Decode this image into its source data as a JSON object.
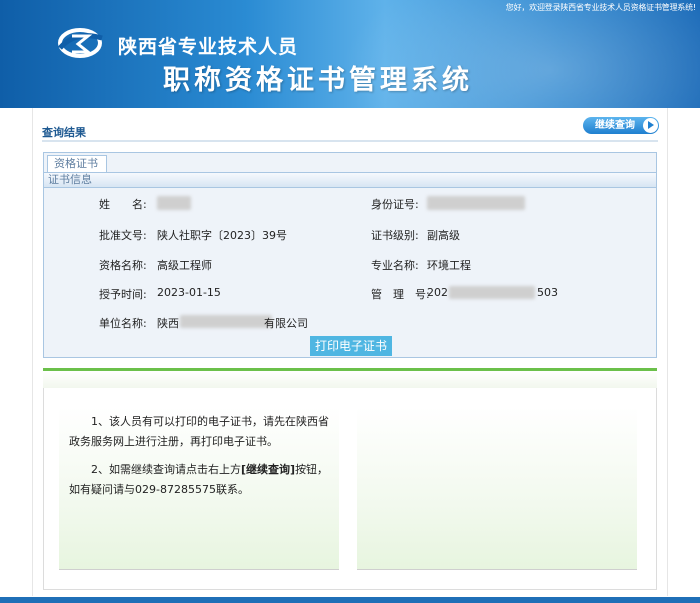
{
  "header": {
    "welcome": "您好，欢迎登录陕西省专业技术人员资格证书管理系统!",
    "title_main": "陕西省专业技术人员",
    "title_sub": "职称资格证书管理系统"
  },
  "result": {
    "title": "查询结果",
    "continue_button": "继续查询"
  },
  "cert": {
    "tab_label": "资格证书",
    "section_label": "证书信息",
    "fields": {
      "name_label": "姓　　名:",
      "id_label": "身份证号:",
      "doc_label": "批准文号:",
      "doc_value": "陕人社职字〔2023〕39号",
      "level_label": "证书级别:",
      "level_value": "副高级",
      "qual_label": "资格名称:",
      "qual_value": "高级工程师",
      "major_label": "专业名称:",
      "major_value": "环境工程",
      "date_label": "授予时间:",
      "date_value": "2023-01-15",
      "mgmt_label": "管　理　号:",
      "mgmt_prefix": "202",
      "mgmt_suffix": "503",
      "unit_label": "单位名称:",
      "unit_prefix": "陕西",
      "unit_suffix": "有限公司"
    },
    "print_button": "打印电子证书"
  },
  "notes": {
    "line1": "1、该人员有可以打印的电子证书，请先在陕西省政务服务网上进行注册，再打印电子证书。",
    "line2_a": "2、如需继续查询请点击右上方",
    "line2_b": "[继续查询]",
    "line2_c": "按钮，如有疑问请与029-87285575联系。"
  },
  "colors": {
    "brand_blue": "#2a8bd3",
    "print_button": "#4fb6e2",
    "green_accent": "#6bc04a"
  }
}
